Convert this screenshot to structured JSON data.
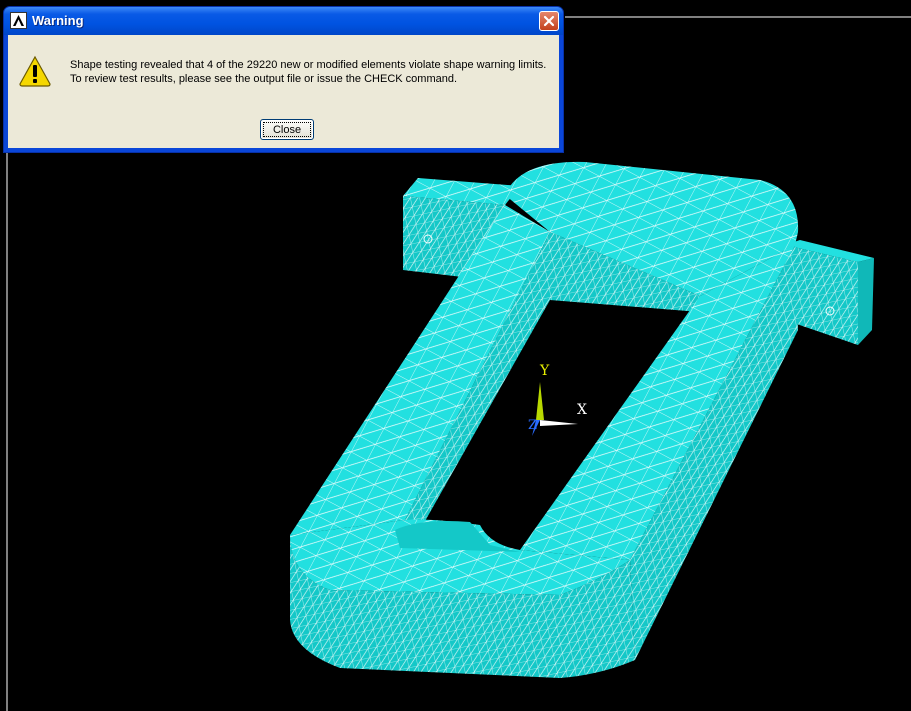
{
  "dialog": {
    "title": "Warning",
    "message_line1": "Shape testing revealed that 4 of the 29220 new or modified elements violate shape warning limits.",
    "message_line2": "To review test results, please see the output file or issue the CHECK command.",
    "close_button_label": "Close",
    "icon": "warning-icon",
    "app_icon": "ansys-logo-icon"
  },
  "viewport": {
    "triad": {
      "x_label": "X",
      "y_label": "Y",
      "z_label": "Z"
    },
    "mesh_color": "#00e8e8",
    "background": "#000000"
  }
}
